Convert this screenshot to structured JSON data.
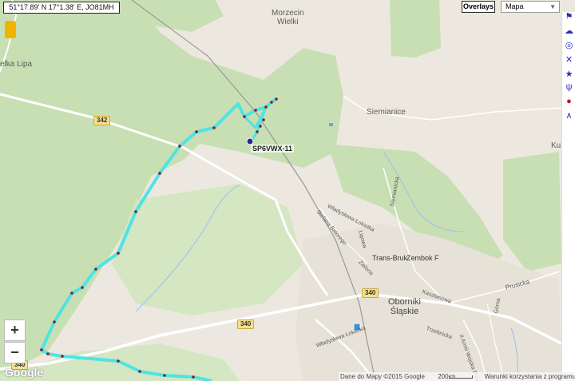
{
  "coordinates": "51°17.89' N 17°1.38' E, JO81MH",
  "controls": {
    "overlays_label": "Overlays",
    "map_type": "Mapa"
  },
  "places": {
    "morzecin": "Morzecin\nWielki",
    "siemianice": "Siemianice",
    "ku": "Ku",
    "wielka_lipa": "elka Lipa",
    "oborniki": "Oborniki\nŚląskie",
    "trans_bruk": "Trans-Bruk",
    "zembok": "Zembok F"
  },
  "streets": {
    "wladyslawa_lokietka_top": "Władysława Łokietka",
    "stefana_batorego": "Stefana Batorego",
    "siemianicka": "Siemianicka",
    "ligowa": "Ligowa",
    "zielona": "Zielona",
    "kasztanowa": "Kasztanowa",
    "prusicka": "Prusicka",
    "gorna": "Górna",
    "trzebnicka": "Trzebnicka",
    "armii_wojska": "II Armii Wojska Polskiego",
    "wladyslawa_lokietka_bottom": "Władysława Łokietka"
  },
  "road_numbers": {
    "r342": "342",
    "r340a": "340",
    "r340b": "340",
    "r340c": "340"
  },
  "station": {
    "callsign": "SP6VWX-11"
  },
  "colors": {
    "track": "#4ee4e4",
    "track_points": "#8b1a2f",
    "forest": "#c8dfb4",
    "road_major": "#ffffff",
    "road_shield": "#f6e08c"
  },
  "footer": {
    "google": "Google",
    "attribution": "Dane do Mapy ©2015 Google",
    "scale": "200 m",
    "terms": "Warunki korzystania z programu"
  },
  "zoom": {
    "plus": "+",
    "minus": "−"
  }
}
